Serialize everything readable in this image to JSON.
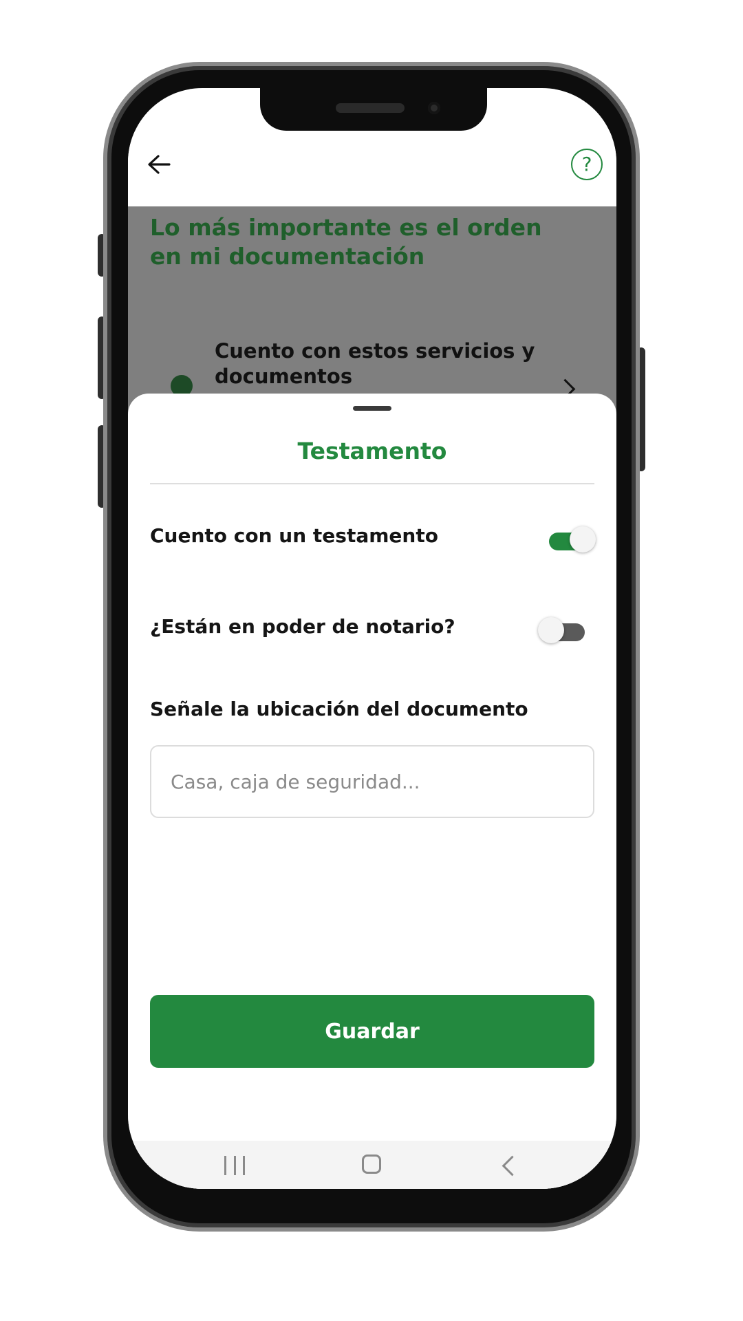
{
  "header": {
    "back_icon": "arrow-left-icon",
    "help_symbol": "?",
    "help_icon": "question-circle-icon"
  },
  "background_page": {
    "title": "Lo más importante es el orden en mi documentación",
    "row_text": "Cuento con estos servicios y documentos"
  },
  "sheet": {
    "title": "Testamento",
    "toggles": [
      {
        "label": "Cuento con un testamento",
        "on": true
      },
      {
        "label": "¿Están en poder de notario?",
        "on": false
      }
    ],
    "location_label": "Señale la ubicación del documento",
    "location_value": "",
    "location_placeholder": "Casa, caja de seguridad...",
    "save_label": "Guardar"
  },
  "navbar": {
    "items": [
      "recent-apps-icon",
      "home-icon",
      "back-icon"
    ]
  },
  "colors": {
    "accent": "#23893f",
    "title_dark_green": "#1f5f2b",
    "scrim": "#7f7f7f"
  }
}
